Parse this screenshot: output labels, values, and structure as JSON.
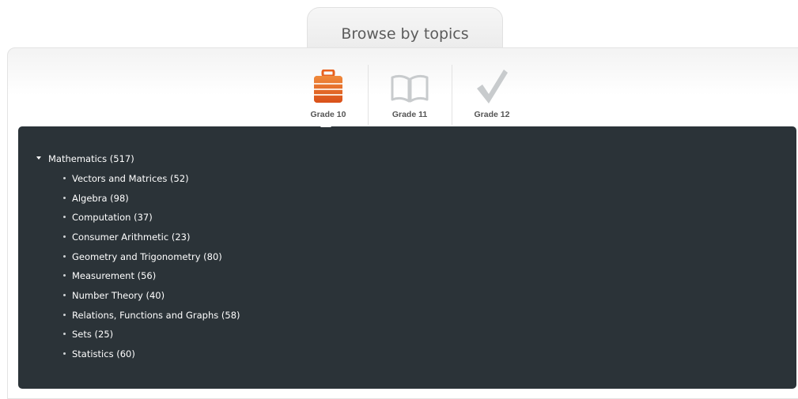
{
  "header": {
    "title": "Browse by topics"
  },
  "grades": [
    {
      "label": "Grade 10",
      "icon": "briefcase-icon",
      "active": true,
      "color": "#e8611f"
    },
    {
      "label": "Grade 11",
      "icon": "book-icon",
      "active": false,
      "color": "#c8cbcd"
    },
    {
      "label": "Grade 12",
      "icon": "checkmark-icon",
      "active": false,
      "color": "#c8cbcd"
    }
  ],
  "tree": {
    "root": "Mathematics (517)",
    "children": [
      "Vectors and Matrices (52)",
      "Algebra (98)",
      "Computation (37)",
      "Consumer Arithmetic (23)",
      "Geometry and Trigonometry (80)",
      "Measurement (56)",
      "Number Theory (40)",
      "Relations, Functions and Graphs (58)",
      "Sets (25)",
      "Statistics (60)"
    ]
  }
}
